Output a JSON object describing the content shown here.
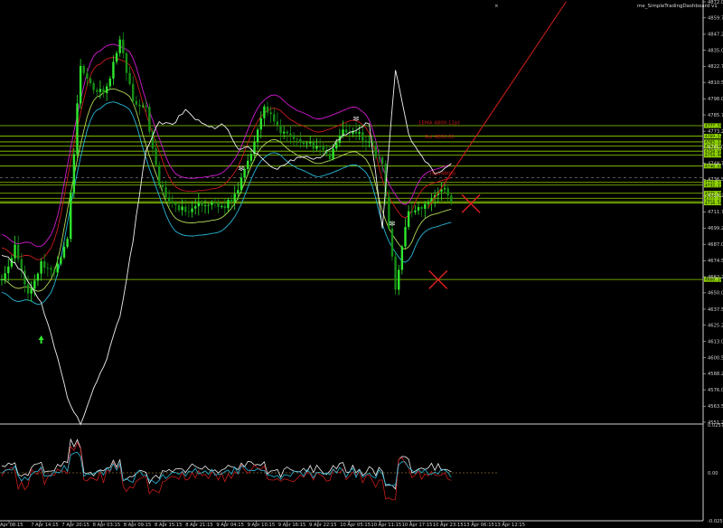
{
  "window": {
    "close_glyph": "×",
    "indicator_title": "me_SimpleTradingDashboard v1"
  },
  "colors": {
    "background": "#000000",
    "bull": "#2ee62e",
    "bear": "#168f16",
    "band_outer": "#d11ad1",
    "band_inner": "#c81c1c",
    "band_lower": "#28b8d8",
    "band_lower_inner": "#b3d957",
    "oscillator": "#f0f0f0",
    "levels": "#8fd400",
    "trend": "#c81c1c",
    "axis_text": "#cfcfcf"
  },
  "chart_data": {
    "type": "candlestick",
    "x_tick_labels": [
      "Apr 08:15",
      "7 Apr 14:15",
      "7 Apr 20:15",
      "8 Apr 03:15",
      "8 Apr 09:15",
      "8 Apr 15:15",
      "8 Apr 21:15",
      "9 Apr 04:15",
      "9 Apr 10:15",
      "9 Apr 16:15",
      "9 Apr 22:15",
      "10 Apr 05:15",
      "10 Apr 11:15",
      "10 Apr 17:15",
      "10 Apr 23:15",
      "13 Apr 06:15",
      "13 Apr 12:15"
    ],
    "y_ticks": [
      4872.0,
      4859.75,
      4847.25,
      4835.0,
      4822.75,
      4810.5,
      4798.0,
      4785.75,
      4773.25,
      4761.0,
      4748.75,
      4736.5,
      4724.25,
      4711.75,
      4699.25,
      4687.0,
      4674.5,
      4662.25,
      4650.0,
      4637.5,
      4625.25,
      4613.0,
      4600.5,
      4588.25,
      4576.0,
      4563.5,
      4551.25
    ],
    "ylim": [
      4551.25,
      4872.0
    ],
    "level_labels": [
      "4777.50",
      "4769.52",
      "4765.12",
      "4762.00",
      "4758.04",
      "4754.98",
      "4746.68",
      "4734.21",
      "4732.13",
      "4725.96",
      "4722.14",
      "4719.51",
      "4718.56",
      "4660.14"
    ],
    "annotations": [
      {
        "text": "1EMA 4800.12pt",
        "price": 4778.5,
        "bar": 127
      },
      {
        "text": "Rsi 4800.00",
        "price": 4767.8,
        "bar": 129
      },
      {
        "text": "...(Spv4800)",
        "price": 4739.8,
        "bar": 129
      }
    ],
    "price_series": [
      {
        "bar": 0,
        "close": 4660
      },
      {
        "bar": 4,
        "close": 4684
      },
      {
        "bar": 8,
        "close": 4647
      },
      {
        "bar": 12,
        "close": 4672
      },
      {
        "bar": 16,
        "close": 4668
      },
      {
        "bar": 20,
        "close": 4690
      },
      {
        "bar": 24,
        "close": 4826
      },
      {
        "bar": 28,
        "close": 4802
      },
      {
        "bar": 32,
        "close": 4806
      },
      {
        "bar": 36,
        "close": 4842
      },
      {
        "bar": 40,
        "close": 4798
      },
      {
        "bar": 44,
        "close": 4790
      },
      {
        "bar": 48,
        "close": 4732
      },
      {
        "bar": 52,
        "close": 4718
      },
      {
        "bar": 56,
        "close": 4712
      },
      {
        "bar": 60,
        "close": 4720
      },
      {
        "bar": 64,
        "close": 4718
      },
      {
        "bar": 68,
        "close": 4715
      },
      {
        "bar": 72,
        "close": 4728
      },
      {
        "bar": 76,
        "close": 4758
      },
      {
        "bar": 80,
        "close": 4793
      },
      {
        "bar": 84,
        "close": 4775
      },
      {
        "bar": 88,
        "close": 4769
      },
      {
        "bar": 92,
        "close": 4761
      },
      {
        "bar": 96,
        "close": 4763
      },
      {
        "bar": 100,
        "close": 4755
      },
      {
        "bar": 104,
        "close": 4773
      },
      {
        "bar": 108,
        "close": 4774
      },
      {
        "bar": 112,
        "close": 4764
      },
      {
        "bar": 116,
        "close": 4748
      },
      {
        "bar": 120,
        "close": 4655
      },
      {
        "bar": 124,
        "close": 4712
      },
      {
        "bar": 128,
        "close": 4717
      },
      {
        "bar": 132,
        "close": 4722
      },
      {
        "bar": 135,
        "close": 4732
      },
      {
        "bar": 137,
        "close": 4722
      }
    ],
    "white_line": [
      {
        "bar": 0,
        "price": 4680
      },
      {
        "bar": 4,
        "price": 4672
      },
      {
        "bar": 8,
        "price": 4660
      },
      {
        "bar": 12,
        "price": 4642
      },
      {
        "bar": 16,
        "price": 4610
      },
      {
        "bar": 20,
        "price": 4570
      },
      {
        "bar": 24,
        "price": 4550
      },
      {
        "bar": 28,
        "price": 4576
      },
      {
        "bar": 32,
        "price": 4600
      },
      {
        "bar": 36,
        "price": 4632
      },
      {
        "bar": 40,
        "price": 4690
      },
      {
        "bar": 44,
        "price": 4760
      },
      {
        "bar": 48,
        "price": 4780
      },
      {
        "bar": 52,
        "price": 4778
      },
      {
        "bar": 56,
        "price": 4790
      },
      {
        "bar": 60,
        "price": 4781
      },
      {
        "bar": 64,
        "price": 4776
      },
      {
        "bar": 68,
        "price": 4778
      },
      {
        "bar": 72,
        "price": 4760
      },
      {
        "bar": 76,
        "price": 4760
      },
      {
        "bar": 80,
        "price": 4750
      },
      {
        "bar": 84,
        "price": 4745
      },
      {
        "bar": 88,
        "price": 4750
      },
      {
        "bar": 92,
        "price": 4755
      },
      {
        "bar": 96,
        "price": 4752
      },
      {
        "bar": 100,
        "price": 4760
      },
      {
        "bar": 104,
        "price": 4770
      },
      {
        "bar": 108,
        "price": 4775
      },
      {
        "bar": 112,
        "price": 4780
      },
      {
        "bar": 116,
        "price": 4700
      },
      {
        "bar": 120,
        "price": 4820
      },
      {
        "bar": 124,
        "price": 4770
      },
      {
        "bar": 128,
        "price": 4755
      },
      {
        "bar": 132,
        "price": 4740
      },
      {
        "bar": 135,
        "price": 4745
      },
      {
        "bar": 137,
        "price": 4748
      }
    ],
    "trend_line": {
      "from": {
        "bar": 130,
        "price": 4715
      },
      "to": {
        "bar": 172,
        "price": 4872
      }
    },
    "cross_marks": [
      {
        "bar": 143,
        "price": 4718
      },
      {
        "bar": 133,
        "price": 4660
      }
    ],
    "up_arrow": {
      "bar": 12,
      "price": 4614
    },
    "wave_marks": [
      {
        "bar": 73,
        "price": 4746
      },
      {
        "bar": 108,
        "price": 4784
      },
      {
        "bar": 119,
        "price": 4704
      }
    ],
    "sub_panel": {
      "y_tick_labels": [
        "0.0257",
        "0.00",
        "-0.0257"
      ],
      "ylim": [
        -0.0257,
        0.0257
      ]
    }
  }
}
